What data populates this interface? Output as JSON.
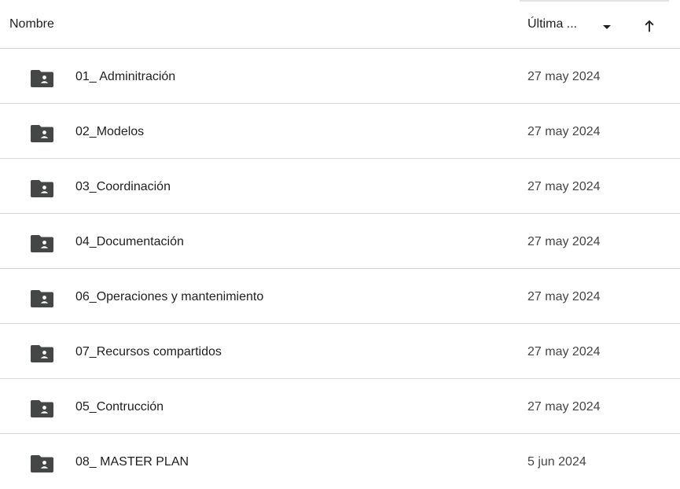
{
  "header": {
    "name_label": "Nombre",
    "date_label": "Última ...",
    "sort_direction_icon": "arrow-up-icon",
    "dropdown_icon": "caret-down-icon"
  },
  "colors": {
    "folder_icon": "#444746",
    "divider": "#d6d6d6",
    "text": "#1f1f1f",
    "secondary_text": "#444746"
  },
  "icons": {
    "row_icon": "shared-folder-icon"
  },
  "rows": [
    {
      "name": "01_ Adminitración",
      "date": "27 may 2024"
    },
    {
      "name": "02_Modelos",
      "date": "27 may 2024"
    },
    {
      "name": "03_Coordinación",
      "date": "27 may 2024"
    },
    {
      "name": "04_Documentación",
      "date": "27 may 2024"
    },
    {
      "name": "06_Operaciones y mantenimiento",
      "date": "27 may 2024"
    },
    {
      "name": "07_Recursos compartidos",
      "date": "27 may 2024"
    },
    {
      "name": "05_Contrucción",
      "date": "27 may 2024"
    },
    {
      "name": "08_ MASTER PLAN",
      "date": "5 jun 2024"
    }
  ]
}
